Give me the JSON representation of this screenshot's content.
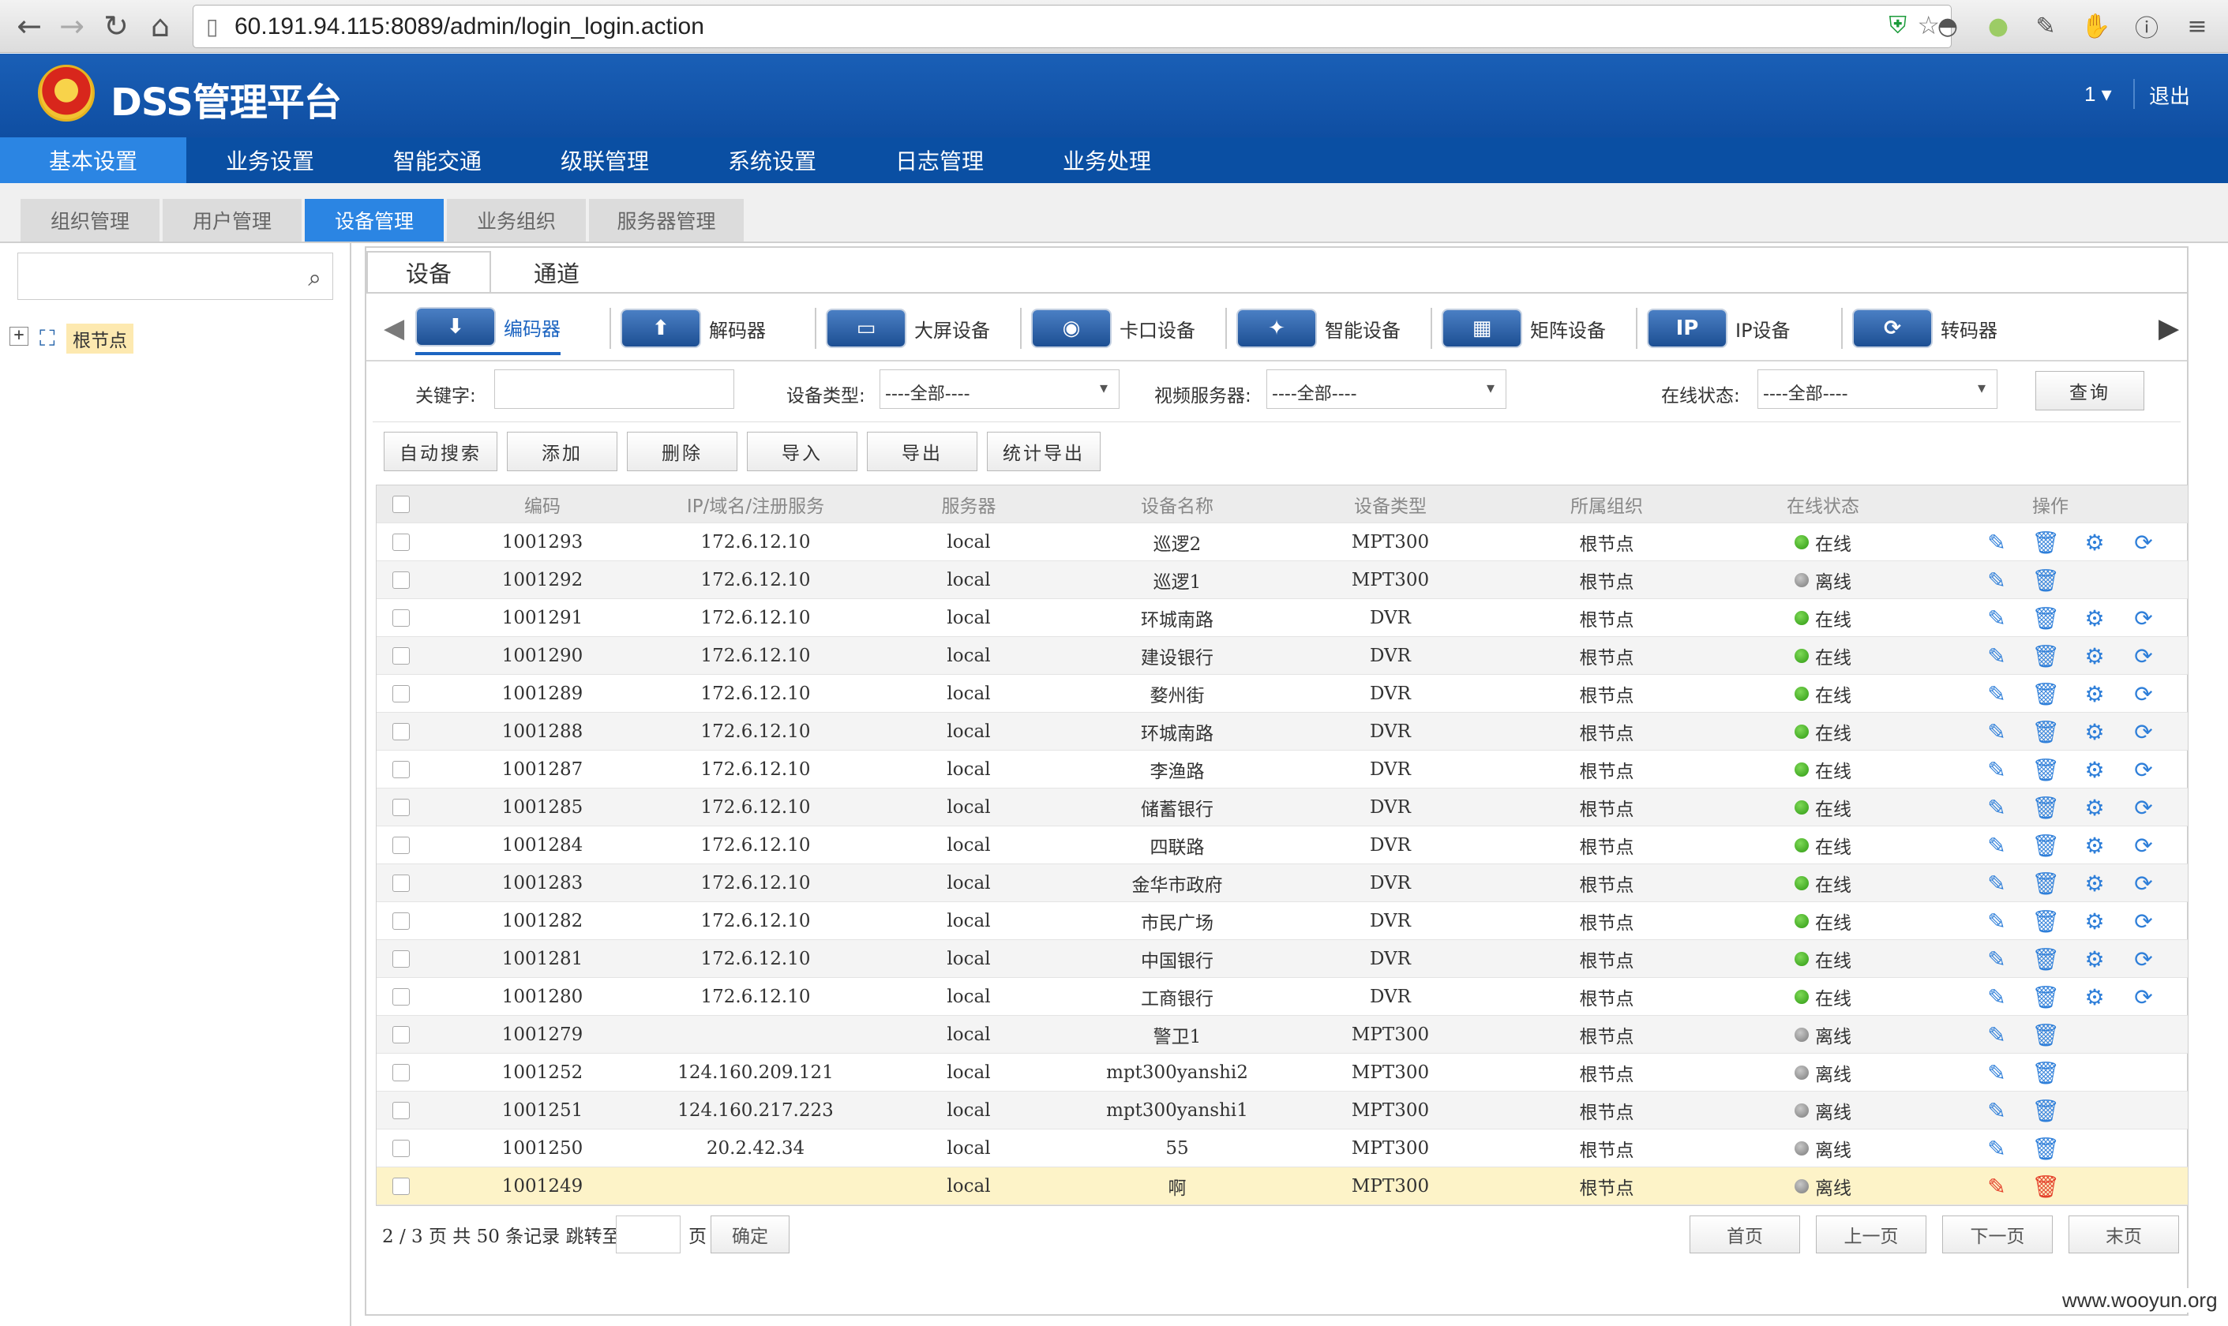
{
  "browser": {
    "url": "60.191.94.115:8089/admin/login_login.action",
    "back_icon": "arrow-left-icon",
    "forward_icon": "arrow-right-icon",
    "reload_icon": "reload-icon",
    "home_icon": "home-icon"
  },
  "header": {
    "title": "DSS管理平台",
    "user": "1 ▾",
    "logout": "退出"
  },
  "main_nav": [
    "基本设置",
    "业务设置",
    "智能交通",
    "级联管理",
    "系统设置",
    "日志管理",
    "业务处理"
  ],
  "main_nav_active": "基本设置",
  "sub_nav": [
    "组织管理",
    "用户管理",
    "设备管理",
    "业务组织",
    "服务器管理"
  ],
  "sub_nav_active": "设备管理",
  "sidebar": {
    "search_placeholder": "",
    "tree_root": "根节点"
  },
  "content_tabs": [
    "设备",
    "通道"
  ],
  "content_tab_active": "设备",
  "device_types": [
    {
      "label": "编码器",
      "icon": "encoder-icon",
      "glyph": "⬇"
    },
    {
      "label": "解码器",
      "icon": "decoder-icon",
      "glyph": "⬆"
    },
    {
      "label": "大屏设备",
      "icon": "screen-device-icon",
      "glyph": "▭"
    },
    {
      "label": "卡口设备",
      "icon": "checkpoint-device-icon",
      "glyph": "◉"
    },
    {
      "label": "智能设备",
      "icon": "smart-device-icon",
      "glyph": "✦"
    },
    {
      "label": "矩阵设备",
      "icon": "matrix-device-icon",
      "glyph": "▦"
    },
    {
      "label": "IP设备",
      "icon": "ip-device-icon",
      "glyph": "IP"
    },
    {
      "label": "转码器",
      "icon": "transcoder-icon",
      "glyph": "⟳"
    }
  ],
  "device_type_active": "编码器",
  "filters": {
    "keyword_label": "关键字:",
    "keyword_value": "",
    "device_type_label": "设备类型:",
    "device_type_value": "----全部----",
    "video_server_label": "视频服务器:",
    "video_server_value": "----全部----",
    "online_status_label": "在线状态:",
    "online_status_value": "----全部----",
    "query_button": "查询"
  },
  "toolbar": [
    "自动搜索",
    "添加",
    "删除",
    "导入",
    "导出",
    "统计导出"
  ],
  "table": {
    "headers": [
      "编码",
      "IP/域名/注册服务",
      "服务器",
      "设备名称",
      "设备类型",
      "所属组织",
      "在线状态",
      "操作"
    ],
    "rows": [
      {
        "code": "1001293",
        "ip": "172.6.12.10",
        "server": "local",
        "name": "巡逻2",
        "type": "MPT300",
        "org": "根节点",
        "status": "在线",
        "online": true
      },
      {
        "code": "1001292",
        "ip": "172.6.12.10",
        "server": "local",
        "name": "巡逻1",
        "type": "MPT300",
        "org": "根节点",
        "status": "离线",
        "online": false
      },
      {
        "code": "1001291",
        "ip": "172.6.12.10",
        "server": "local",
        "name": "环城南路",
        "type": "DVR",
        "org": "根节点",
        "status": "在线",
        "online": true
      },
      {
        "code": "1001290",
        "ip": "172.6.12.10",
        "server": "local",
        "name": "建设银行",
        "type": "DVR",
        "org": "根节点",
        "status": "在线",
        "online": true
      },
      {
        "code": "1001289",
        "ip": "172.6.12.10",
        "server": "local",
        "name": "婺州街",
        "type": "DVR",
        "org": "根节点",
        "status": "在线",
        "online": true
      },
      {
        "code": "1001288",
        "ip": "172.6.12.10",
        "server": "local",
        "name": "环城南路",
        "type": "DVR",
        "org": "根节点",
        "status": "在线",
        "online": true
      },
      {
        "code": "1001287",
        "ip": "172.6.12.10",
        "server": "local",
        "name": "李渔路",
        "type": "DVR",
        "org": "根节点",
        "status": "在线",
        "online": true
      },
      {
        "code": "1001285",
        "ip": "172.6.12.10",
        "server": "local",
        "name": "储蓄银行",
        "type": "DVR",
        "org": "根节点",
        "status": "在线",
        "online": true
      },
      {
        "code": "1001284",
        "ip": "172.6.12.10",
        "server": "local",
        "name": "四联路",
        "type": "DVR",
        "org": "根节点",
        "status": "在线",
        "online": true
      },
      {
        "code": "1001283",
        "ip": "172.6.12.10",
        "server": "local",
        "name": "金华市政府",
        "type": "DVR",
        "org": "根节点",
        "status": "在线",
        "online": true
      },
      {
        "code": "1001282",
        "ip": "172.6.12.10",
        "server": "local",
        "name": "市民广场",
        "type": "DVR",
        "org": "根节点",
        "status": "在线",
        "online": true
      },
      {
        "code": "1001281",
        "ip": "172.6.12.10",
        "server": "local",
        "name": "中国银行",
        "type": "DVR",
        "org": "根节点",
        "status": "在线",
        "online": true
      },
      {
        "code": "1001280",
        "ip": "172.6.12.10",
        "server": "local",
        "name": "工商银行",
        "type": "DVR",
        "org": "根节点",
        "status": "在线",
        "online": true
      },
      {
        "code": "1001279",
        "ip": "",
        "server": "local",
        "name": "警卫1",
        "type": "MPT300",
        "org": "根节点",
        "status": "离线",
        "online": false
      },
      {
        "code": "1001252",
        "ip": "124.160.209.121",
        "server": "local",
        "name": "mpt300yanshi2",
        "type": "MPT300",
        "org": "根节点",
        "status": "离线",
        "online": false
      },
      {
        "code": "1001251",
        "ip": "124.160.217.223",
        "server": "local",
        "name": "mpt300yanshi1",
        "type": "MPT300",
        "org": "根节点",
        "status": "离线",
        "online": false
      },
      {
        "code": "1001250",
        "ip": "20.2.42.34",
        "server": "local",
        "name": "55",
        "type": "MPT300",
        "org": "根节点",
        "status": "离线",
        "online": false
      },
      {
        "code": "1001249",
        "ip": "",
        "server": "local",
        "name": "啊",
        "type": "MPT300",
        "org": "根节点",
        "status": "离线",
        "online": false,
        "highlighted": true
      }
    ]
  },
  "pagination": {
    "info": "2 / 3 页 共 50 条记录 跳转至",
    "jump_value": "",
    "page_suffix": "页",
    "confirm": "确定",
    "first": "首页",
    "prev": "上一页",
    "next": "下一页",
    "last": "末页"
  },
  "watermark": "www.wooyun.org",
  "colors": {
    "header_blue": "#0f4ea2",
    "nav_active": "#2b85e3",
    "online_green": "#2e9a12",
    "offline_gray": "#7a7a7a",
    "action_blue": "#2f7fd9",
    "highlight_row": "#fdf3c8"
  }
}
